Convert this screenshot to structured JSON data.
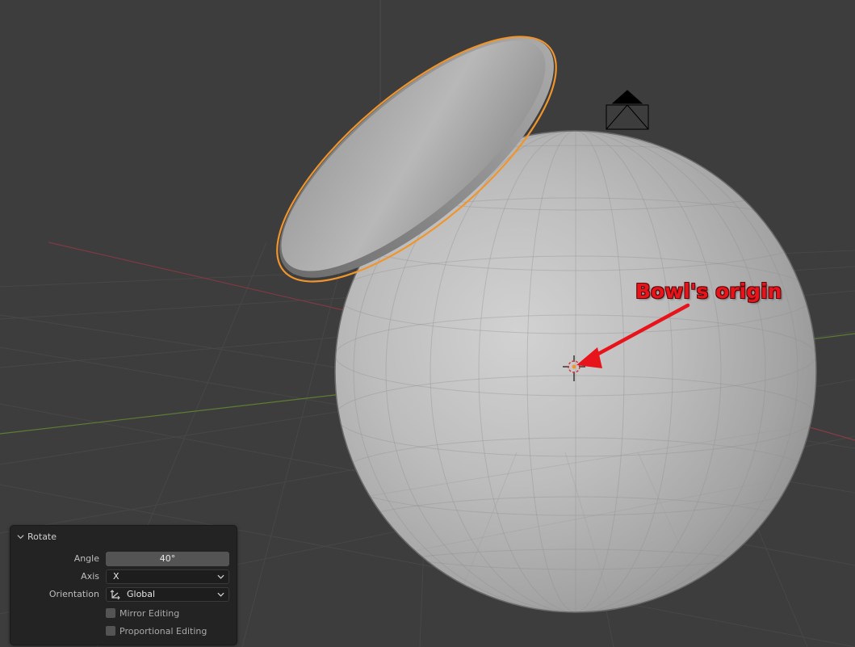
{
  "viewport": {
    "annotation": "Bowl's origin",
    "colors": {
      "background": "#3d3d3d",
      "selection_outline": "#f0952c",
      "annotation": "#e8141b",
      "x_axis": "#8a3b43",
      "y_axis": "#5e7d33"
    },
    "objects": [
      "bowl",
      "sphere",
      "camera",
      "origin-marker"
    ]
  },
  "operator_panel": {
    "title": "Rotate",
    "collapse_icon": "chevron-down-icon",
    "angle": {
      "label": "Angle",
      "value": "40°"
    },
    "axis": {
      "label": "Axis",
      "value": "X"
    },
    "orientation": {
      "label": "Orientation",
      "value": "Global",
      "icon": "orientation-global-icon"
    },
    "mirror_editing": {
      "label": "Mirror Editing",
      "checked": false
    },
    "proportional_editing": {
      "label": "Proportional Editing",
      "checked": false
    }
  }
}
